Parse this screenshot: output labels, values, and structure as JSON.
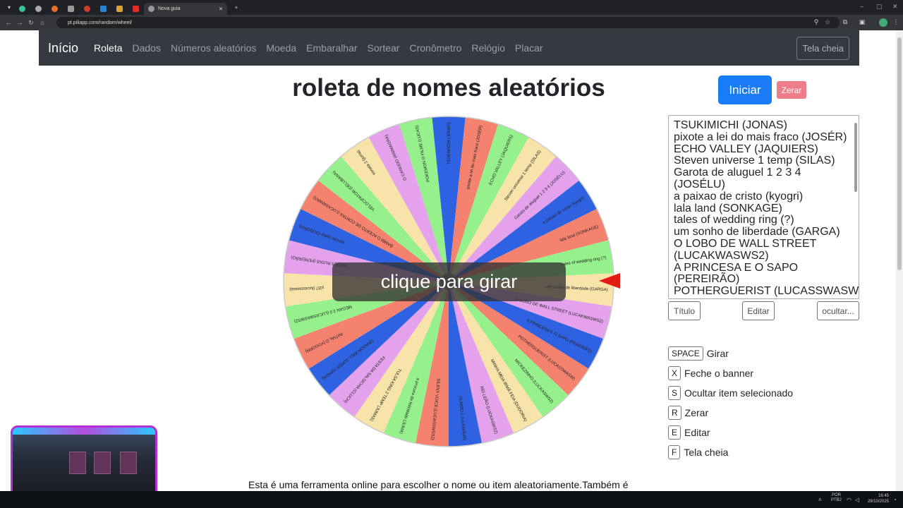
{
  "browser": {
    "active_tab_title": "Nova guia",
    "url": "pt.piliapp.com/random/wheel/"
  },
  "navbar": {
    "brand": "Início",
    "links": [
      "Roleta",
      "Dados",
      "Números aleatórios",
      "Moeda",
      "Embaralhar",
      "Sortear",
      "Cronômetro",
      "Relógio",
      "Placar"
    ],
    "active": "Roleta",
    "fullscreen_label": "Tela cheia"
  },
  "page_title": "roleta de nomes aleatórios",
  "buttons": {
    "start": "Iniciar",
    "reset": "Zerar",
    "title": "Título",
    "edit": "Editar",
    "hide": "ocultar..."
  },
  "spin_overlay": "clique para girar",
  "names_list": [
    "TSUKIMICHI (JONAS)",
    "pixote a lei do mais fraco (JOSÉR)",
    "ECHO VALLEY (JAQUIERS)",
    "Steven universe 1 temp (SILAS)",
    "Garota de aluguel 1 2 3 4",
    "(JOSÉLU)",
    "a paixao de cristo (kyogri)",
    "lala land (SONKAGE)",
    "tales of wedding ring (?)",
    "um sonho de liberdade (GARGA)",
    "O LOBO DE WALL STREET",
    "(LUCAKWASWS2)",
    "A PRINCESA E O SAPO",
    "(PEREIRÃO)",
    "POTHERGUERIST (LUCASSWASW)"
  ],
  "wheel": {
    "segments": [
      {
        "label": "TSUKIMICHI (JONAS)",
        "color": "#2f62e0"
      },
      {
        "label": "pixote a lei do mais fraco (JOSÉR)",
        "color": "#f5826e"
      },
      {
        "label": "ECHO VALLEY (JAQUIERS)",
        "color": "#96f08c"
      },
      {
        "label": "Steven universe 1 temp (SILAS)",
        "color": "#f8e3a8"
      },
      {
        "label": "Garota de aluguel 1 2 3 4 (JOSÉLU)",
        "color": "#e4a2ec"
      },
      {
        "label": "a paixao de cristo (kyogri)",
        "color": "#2f62e0"
      },
      {
        "label": "lala land (SONKAGE)",
        "color": "#f5826e"
      },
      {
        "label": "tales of wedding ring (?)",
        "color": "#96f08c"
      },
      {
        "label": "um sonho de liberdade (GARGA)",
        "color": "#f8e3a8"
      },
      {
        "label": "O LOBO DE WALL STREET (LUCAKWASWS2)",
        "color": "#e4a2ec"
      },
      {
        "label": "A PRINCESA E O SAPO (PEREIRÃO)",
        "color": "#2f62e0"
      },
      {
        "label": "POTHERGUERIST (LUCASSWASW)",
        "color": "#f5826e"
      },
      {
        "label": "MICKEZINHO (LUCKASWS2)",
        "color": "#96f08c"
      },
      {
        "label": "MINHA MEIA IRMÃ FEIA (DUDORIA)",
        "color": "#f8e3a8"
      },
      {
        "label": "REI LEÃO (LUCKASWS2)",
        "color": "#e4a2ec"
      },
      {
        "label": "DUMBO L A (LENNUR)",
        "color": "#2f62e0"
      },
      {
        "label": "SILENT VOICE (LUCASSWSS2)",
        "color": "#f5826e"
      },
      {
        "label": "a procura da felicidade (JUMA)",
        "color": "#96f08c"
      },
      {
        "label": "TULSA KING 2 TEMP (JUMAS)",
        "color": "#f8e3a8"
      },
      {
        "label": "FESTA DA SALSICHA (CLUCH)",
        "color": "#e4a2ec"
      },
      {
        "label": "DRAGON BALL SUPER (SPADA)",
        "color": "#2f62e0"
      },
      {
        "label": "INITIAL D (VOGORN)",
        "color": "#f5826e"
      },
      {
        "label": "MEGAN 2.0 (LUCASWASWS2)",
        "color": "#96f08c"
      },
      {
        "label": "y2t7 (lucasssssss)",
        "color": "#f8e3a8"
      },
      {
        "label": "NOITES RUTAS (PEREIRÃO)",
        "color": "#e4a2ec"
      },
      {
        "label": "donnie darko (DUDORIA)",
        "color": "#2f62e0"
      },
      {
        "label": "BAMBI O ACERTO DE CONTAS (LUCASWWAS)",
        "color": "#f5826e"
      },
      {
        "label": "VELOCIPATOR (DELUBANA)",
        "color": "#96f08c"
      },
      {
        "label": "sonata 2 (juma)",
        "color": "#f8e3a8"
      },
      {
        "label": "O CANUDO (ANIMAGRA)",
        "color": "#e4a2ec"
      },
      {
        "label": "POKEMON O FILME (LUCAS)",
        "color": "#96f08c"
      }
    ]
  },
  "shortcuts": [
    {
      "key": "SPACE",
      "label": "Girar"
    },
    {
      "key": "X",
      "label": "Feche o banner"
    },
    {
      "key": "S",
      "label": "Ocultar item selecionado"
    },
    {
      "key": "R",
      "label": "Zerar"
    },
    {
      "key": "E",
      "label": "Editar"
    },
    {
      "key": "F",
      "label": "Tela cheia"
    }
  ],
  "footer_text": "Esta é uma ferramenta online para escolher o nome ou item aleatoriamente.Também é",
  "taskbar": {
    "lang": "POR",
    "lang_sub": "PTB2",
    "time": "16:45",
    "date": "28/10/2025"
  }
}
